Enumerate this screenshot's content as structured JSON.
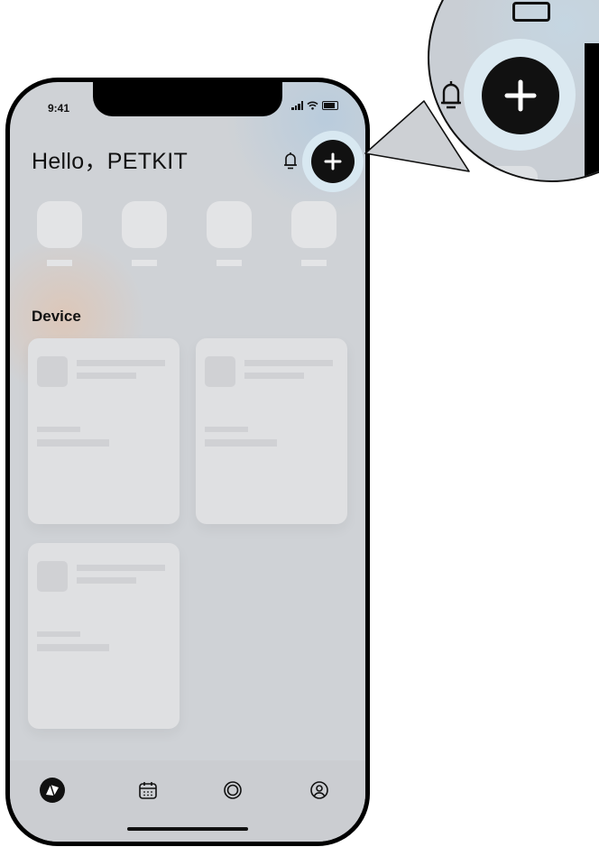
{
  "status_bar": {
    "time": "9:41"
  },
  "header": {
    "greeting": "Hello，PETKIT"
  },
  "section": {
    "title": "Device"
  },
  "quick_items_count_hint": "4 placeholder tiles",
  "tab_bar": {
    "tabs": [
      {
        "icon": "petkit-logo-icon",
        "active": true
      },
      {
        "icon": "calendar-icon",
        "active": false
      },
      {
        "icon": "circle-ring-icon",
        "active": false
      },
      {
        "icon": "user-profile-icon",
        "active": false
      }
    ]
  },
  "colors": {
    "accent": "#111111",
    "highlight": "#d8e8f1",
    "background": "#cfd2d6"
  }
}
